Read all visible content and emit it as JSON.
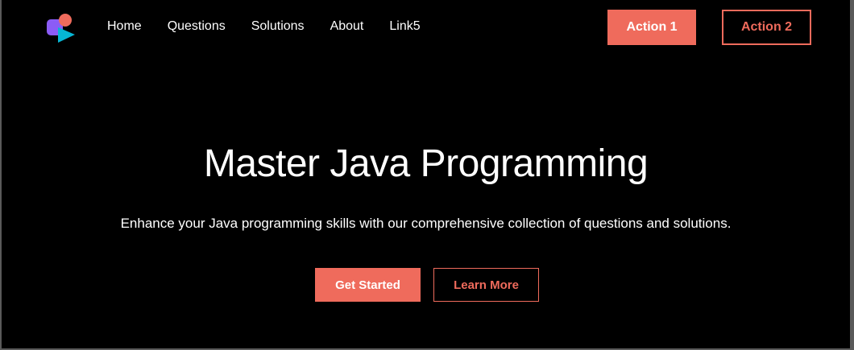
{
  "colors": {
    "background": "#000000",
    "accent": "#ef6b5c",
    "logo_purple": "#8b5cf6",
    "logo_blue": "#06b6d4",
    "text": "#ffffff"
  },
  "logo": {
    "icon": "brand-logo-icon"
  },
  "nav": {
    "links": [
      "Home",
      "Questions",
      "Solutions",
      "About",
      "Link5"
    ]
  },
  "actions": {
    "action1": "Action 1",
    "action2": "Action 2"
  },
  "hero": {
    "title": "Master Java Programming",
    "subtitle": "Enhance your Java programming skills with our comprehensive collection of questions and solutions.",
    "primary_cta": "Get Started",
    "secondary_cta": "Learn More"
  }
}
